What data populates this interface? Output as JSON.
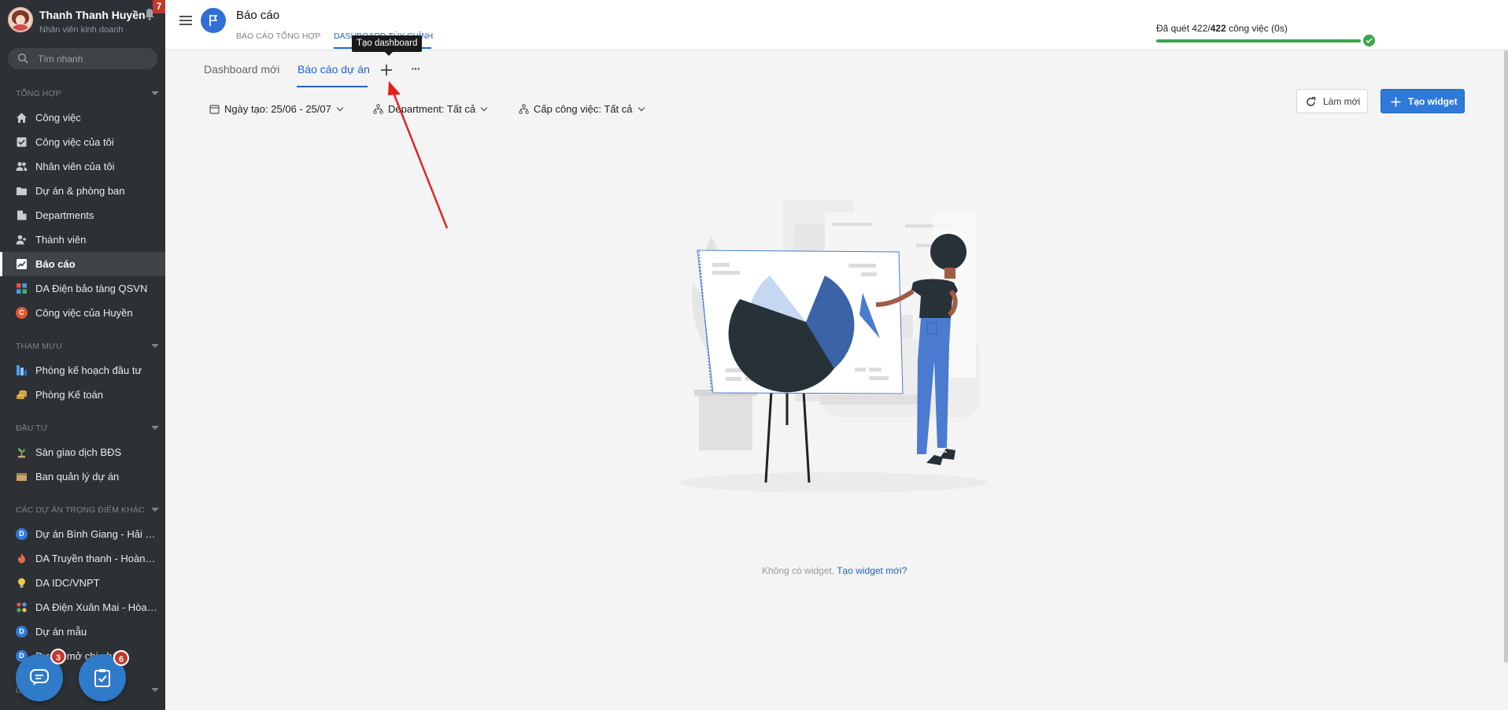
{
  "user": {
    "name": "Thanh Thanh Huyền",
    "role": "Nhân viên kinh doanh",
    "notification_count": "7"
  },
  "search": {
    "placeholder": "Tìm nhanh"
  },
  "sidebar": {
    "sections": [
      {
        "title": "TỔNG HỢP"
      },
      {
        "title": "THAM MƯU"
      },
      {
        "title": "ĐẦU TƯ"
      },
      {
        "title": "CÁC DỰ ÁN TRỌNG ĐIỂM KHÁC"
      },
      {
        "title": "DỰ ÁN"
      }
    ],
    "items": [
      {
        "label": "Công việc",
        "icon": "home-icon"
      },
      {
        "label": "Công việc của tôi",
        "icon": "task-check-icon"
      },
      {
        "label": "Nhân viên của tôi",
        "icon": "people-icon"
      },
      {
        "label": "Dự án & phòng ban",
        "icon": "folder-icon"
      },
      {
        "label": "Departments",
        "icon": "building-icon"
      },
      {
        "label": "Thành viên",
        "icon": "add-person-icon"
      },
      {
        "label": "Báo cáo",
        "icon": "chart-line-icon"
      },
      {
        "label": "DA Điện bảo tàng QSVN",
        "icon": "grid-icon"
      },
      {
        "label": "Công việc của Huyền",
        "icon": "letter-c-icon",
        "letter": "C"
      },
      {
        "label": "Phòng kế hoạch đầu tư",
        "icon": "bars-icon"
      },
      {
        "label": "Phòng Kế toán",
        "icon": "coins-icon"
      },
      {
        "label": "Sàn giao dịch BĐS",
        "icon": "plant-icon"
      },
      {
        "label": "Ban quản lý dự án",
        "icon": "box-icon"
      },
      {
        "label": "Dự án Bình Giang - Hải Dương",
        "icon": "letter-d-icon",
        "letter": "D"
      },
      {
        "label": "DA Truyền thanh - Hoàng Mai",
        "icon": "flame-icon"
      },
      {
        "label": "DA IDC/VNPT",
        "icon": "bulb-icon"
      },
      {
        "label": "DA Điện Xuân Mai - Hòa Bình",
        "icon": "dots-grid-icon"
      },
      {
        "label": "Dự án mẫu",
        "icon": "letter-d-icon",
        "letter": "D"
      },
      {
        "label": "Dự án mở chi nhánh",
        "icon": "letter-d-icon",
        "letter": "D"
      }
    ]
  },
  "fab": {
    "chat_badge": "3",
    "tasks_badge": "6"
  },
  "header": {
    "title": "Báo cáo",
    "tabs": [
      {
        "label": "BÁO CÁO TỔNG HỢP"
      },
      {
        "label": "DASHBOARD TÙY CHỈNH"
      }
    ],
    "tooltip": "Tạo dashboard",
    "scan": {
      "prefix": "Đã quét ",
      "done": "422",
      "sep": "/",
      "total": "422",
      "suffix": " công việc (0s)",
      "progress": 1.0
    }
  },
  "dashboard_tabs": [
    {
      "label": "Dashboard mới"
    },
    {
      "label": "Báo cáo dự án"
    }
  ],
  "filters": [
    {
      "label": "Ngày tạo: ",
      "value": "25/06 - 25/07"
    },
    {
      "label": "Department: ",
      "value": "Tất cả"
    },
    {
      "label": "Cấp công việc: ",
      "value": "Tất cả"
    }
  ],
  "buttons": {
    "refresh": "Làm mới",
    "create_widget": "Tạo widget"
  },
  "empty": {
    "text": "Không có widget. ",
    "link": "Tạo widget mới?"
  },
  "colors": {
    "sidebar_bg": "#2d3135",
    "accent": "#2f7ad8",
    "progress": "#3aa64b",
    "annotation": "#e0201c"
  }
}
